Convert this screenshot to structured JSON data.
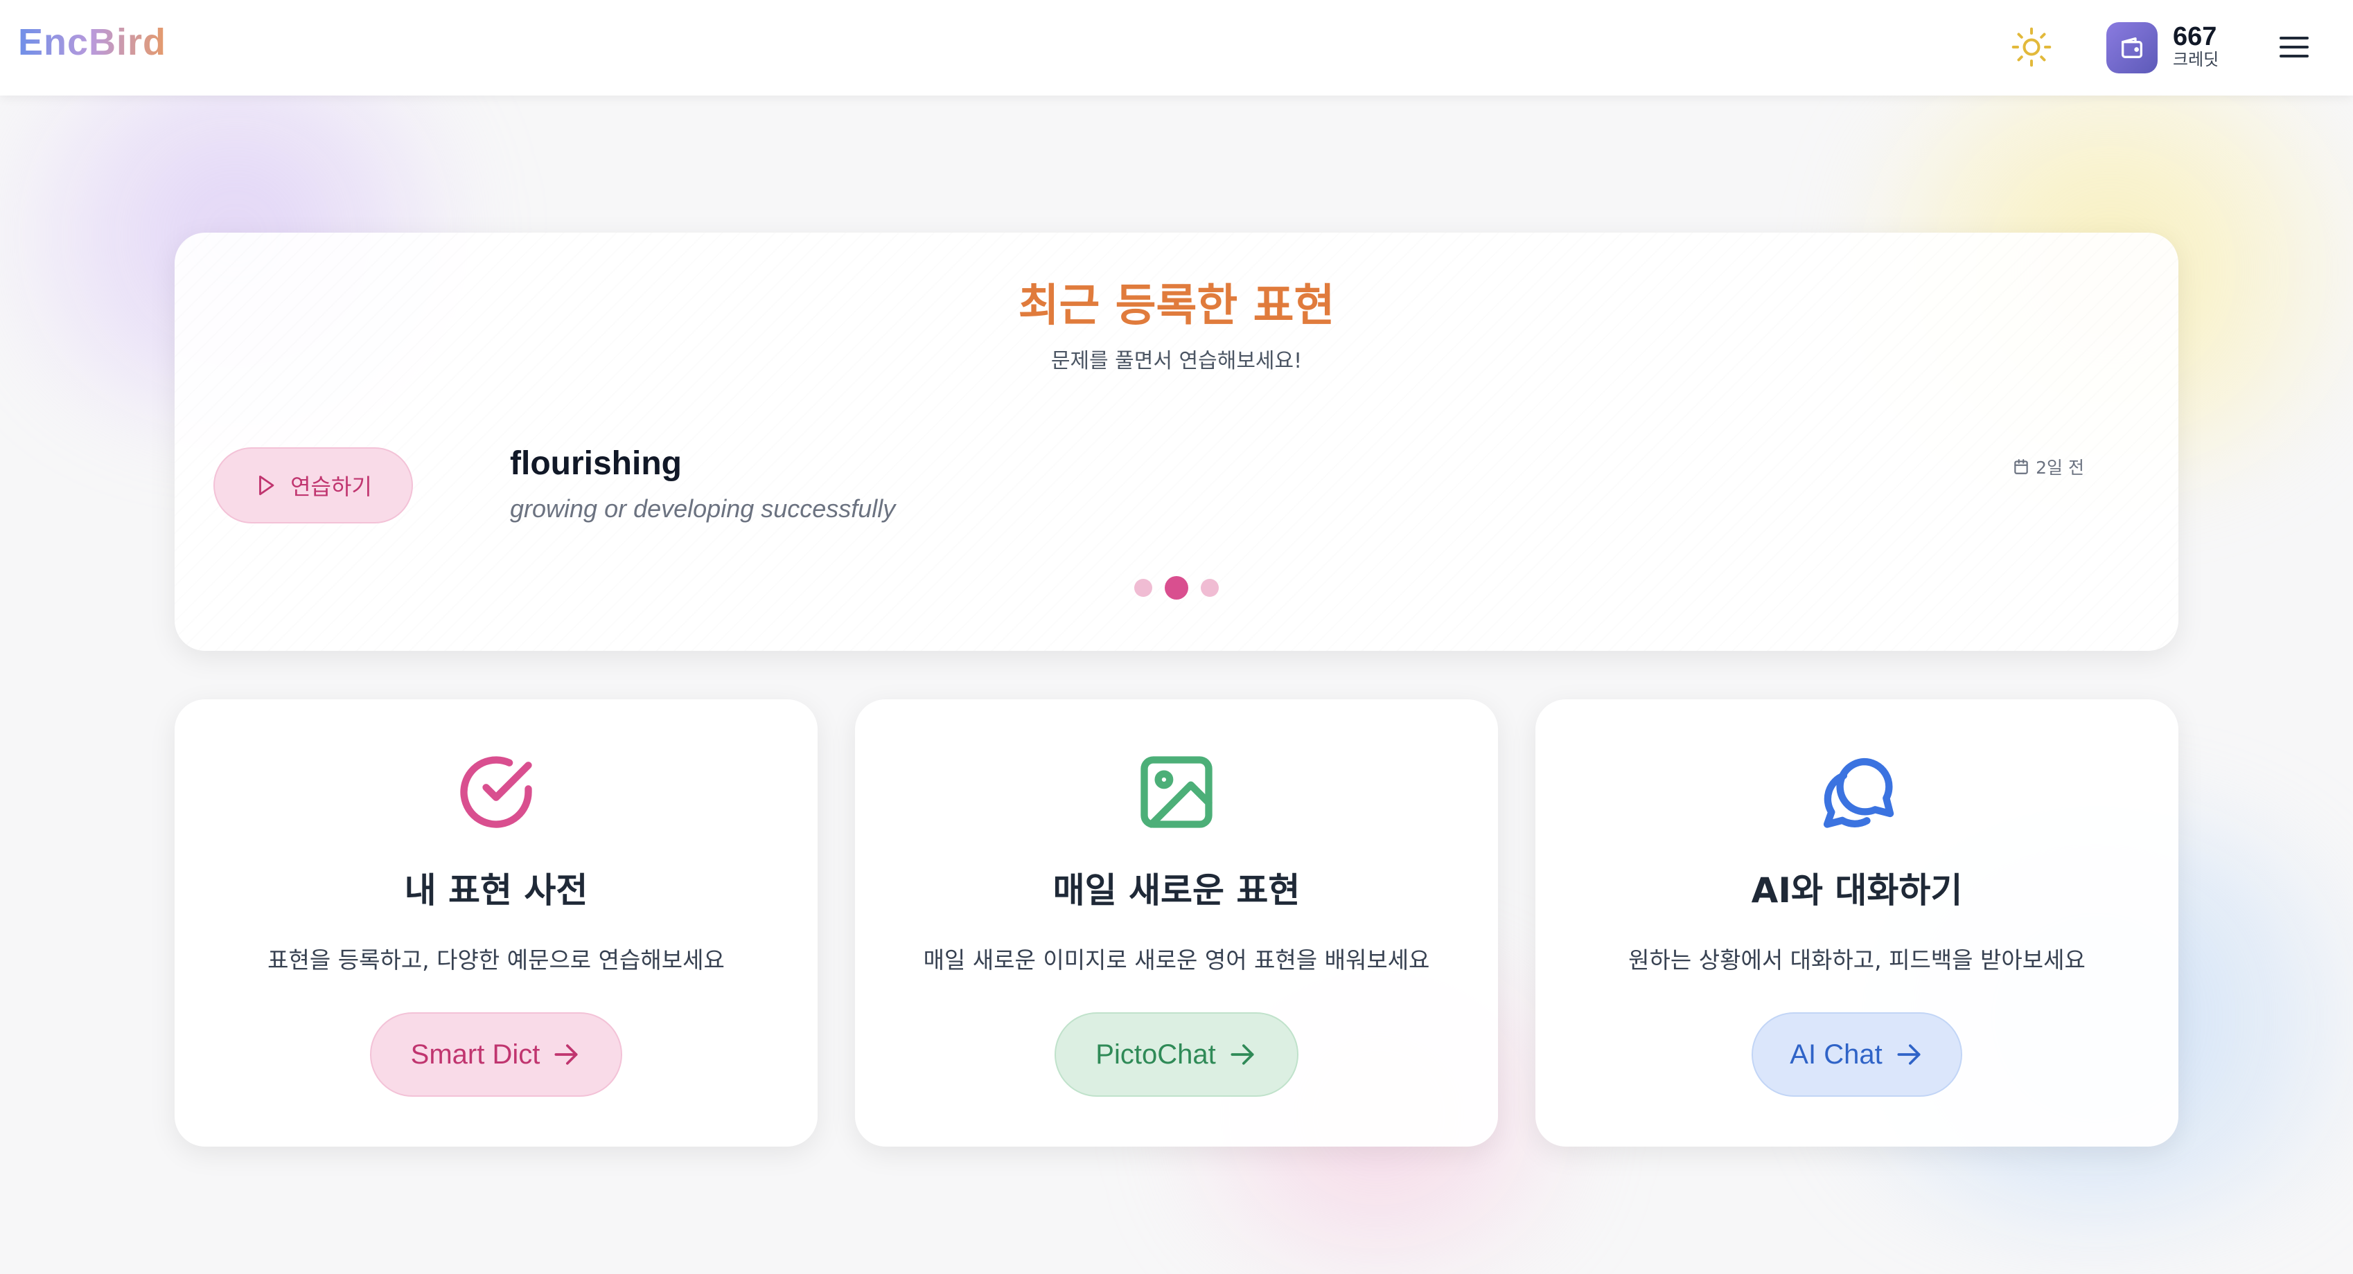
{
  "header": {
    "logo": "EncBird",
    "credits": {
      "amount": "667",
      "label": "크레딧"
    },
    "icons": {
      "theme": "sun-icon",
      "wallet": "wallet-icon",
      "menu": "menu-icon"
    }
  },
  "carousel": {
    "title": "최근 등록한 표현",
    "subtitle": "문제를 풀면서 연습해보세요!",
    "practice_label": "연습하기",
    "expression": {
      "word": "flourishing",
      "meaning": "growing or developing successfully",
      "date": "2일 전"
    },
    "dots": 3,
    "active_dot": 2
  },
  "features": [
    {
      "title": "내 표현 사전",
      "description": "표현을 등록하고, 다양한 예문으로 연습해보세요",
      "button": "Smart Dict",
      "icon": "check-circle-icon"
    },
    {
      "title": "매일 새로운 표현",
      "description": "매일 새로운 이미지로 새로운 영어 표현을 배워보세요",
      "button": "PictoChat",
      "icon": "image-icon"
    },
    {
      "title": "AI와 대화하기",
      "description": "원하는 상황에서 대화하고, 피드백을 받아보세요",
      "button": "AI Chat",
      "icon": "chat-bubbles-icon"
    }
  ],
  "colors": {
    "accent_orange": "#e07b3c",
    "pink": "#d94f8f",
    "green": "#4caf78",
    "blue": "#3b73e0",
    "wallet_purple": "#6a63c7"
  }
}
